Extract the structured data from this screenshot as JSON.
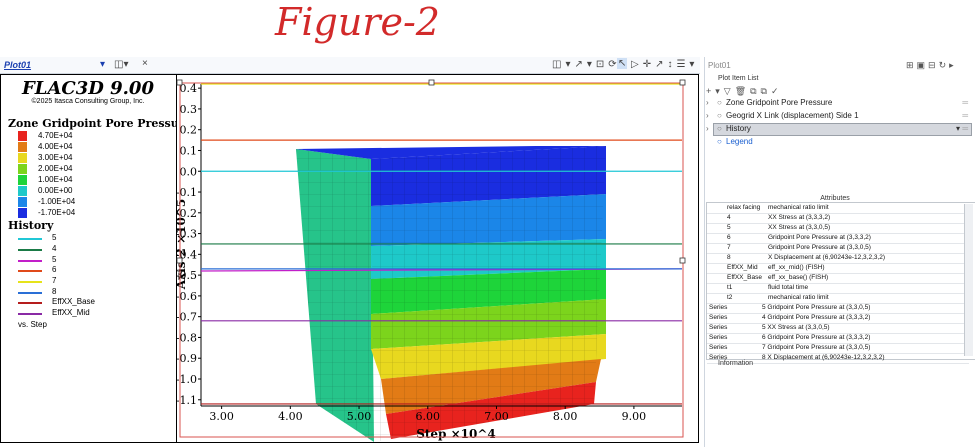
{
  "annotation": {
    "text": "Figure-2"
  },
  "left_toolbar": {
    "tab": "Plot01",
    "close": "×"
  },
  "legend": {
    "app_title": "FLAC3D 9.00",
    "copyright": "©2025 Itasca Consulting Group, Inc.",
    "contour_title": "Zone Gridpoint Pore Pressure",
    "contour_levels": [
      {
        "label": "4.70E+04",
        "color": "#e8231e"
      },
      {
        "label": "4.00E+04",
        "color": "#e27b16"
      },
      {
        "label": "3.00E+04",
        "color": "#e8d81f"
      },
      {
        "label": "2.00E+04",
        "color": "#7cd41c"
      },
      {
        "label": "1.00E+04",
        "color": "#1ed43a"
      },
      {
        "label": "0.00E+00",
        "color": "#1ec9c9"
      },
      {
        "label": "-1.00E+04",
        "color": "#1b86e8"
      },
      {
        "label": "-1.70E+04",
        "color": "#1a2de0"
      }
    ],
    "history_title": "History",
    "histories": [
      {
        "label": "5",
        "color": "#20c7d6"
      },
      {
        "label": "4",
        "color": "#1a7a46"
      },
      {
        "label": "5",
        "color": "#c21ec9"
      },
      {
        "label": "6",
        "color": "#e04a1a"
      },
      {
        "label": "7",
        "color": "#e6e31a"
      },
      {
        "label": "8",
        "color": "#2a6fd6"
      },
      {
        "label": "EffXX_Base",
        "color": "#b51d1d"
      },
      {
        "label": "EffXX_Mid",
        "color": "#8a2aa5"
      }
    ],
    "vs": "vs. Step"
  },
  "chart_data": {
    "type": "line",
    "xlabel": "Step ×10^4",
    "ylabel": "Axis-2 ×10^5",
    "xlim": [
      2.7,
      9.7
    ],
    "ylim": [
      -1.13,
      0.42
    ],
    "x_ticks": [
      "3.00",
      "4.00",
      "5.00",
      "6.00",
      "7.00",
      "8.00",
      "9.00"
    ],
    "y_ticks": [
      "0.4",
      "0.3",
      "0.2",
      "0.1",
      "0.0",
      "-0.1",
      "-0.2",
      "-0.3",
      "-0.4",
      "-0.5",
      "-0.6",
      "-0.7",
      "-0.8",
      "-0.9",
      "-1.0",
      "-1.1"
    ],
    "series": [
      {
        "name": "5",
        "color": "#20c7d6",
        "x": [
          2.7,
          9.7
        ],
        "y": [
          0.0,
          0.0
        ]
      },
      {
        "name": "4",
        "color": "#1a7a46",
        "x": [
          2.7,
          9.7
        ],
        "y": [
          -0.35,
          -0.35
        ]
      },
      {
        "name": "5",
        "color": "#c21ec9",
        "x": [
          2.7,
          9.7
        ],
        "y": [
          -0.48,
          -0.47
        ]
      },
      {
        "name": "6",
        "color": "#e04a1a",
        "x": [
          2.7,
          9.7
        ],
        "y": [
          0.15,
          0.15
        ]
      },
      {
        "name": "7",
        "color": "#e6e31a",
        "x": [
          2.7,
          9.7
        ],
        "y": [
          0.42,
          0.42
        ]
      },
      {
        "name": "8",
        "color": "#2a6fd6",
        "x": [
          2.7,
          9.7
        ],
        "y": [
          -0.47,
          -0.47
        ]
      },
      {
        "name": "EffXX_Base",
        "color": "#b51d1d",
        "x": [
          2.7,
          9.7
        ],
        "y": [
          -1.12,
          -1.12
        ]
      },
      {
        "name": "EffXX_Mid",
        "color": "#8a2aa5",
        "x": [
          2.7,
          9.7
        ],
        "y": [
          -0.72,
          -0.72
        ]
      }
    ]
  },
  "right_panel": {
    "title": "Plot01",
    "plot_item_list": "Plot Item List",
    "items": [
      {
        "label": "Zone Gridpoint Pore Pressure",
        "type": "normal"
      },
      {
        "label": "Geogrid X Link (displacement) Side 1",
        "type": "normal"
      },
      {
        "label": "History",
        "type": "selected"
      },
      {
        "label": "Legend",
        "type": "link"
      }
    ],
    "attributes_title": "Attributes",
    "attributes": [
      {
        "c1": "relax facing",
        "c2": "mechanical ratio limit",
        "series": false
      },
      {
        "c1": "4",
        "c2": "XX Stress at (3,3,3,2)",
        "series": false
      },
      {
        "c1": "5",
        "c2": "XX Stress at (3,3,0,5)",
        "series": false
      },
      {
        "c1": "6",
        "c2": "Gridpoint Pore Pressure at (3,3,3,2)",
        "series": false
      },
      {
        "c1": "7",
        "c2": "Gridpoint Pore Pressure at (3,3,0,5)",
        "series": false
      },
      {
        "c1": "8",
        "c2": "X Displacement at (6,90243e-12,3,2,3,2)",
        "series": false
      },
      {
        "c1": "EffXX_Mid",
        "c2": "eff_xx_mid() (FISH)",
        "series": false
      },
      {
        "c1": "EffXX_Base",
        "c2": "eff_xx_base() (FISH)",
        "series": false
      },
      {
        "c1": "t1",
        "c2": "fluid total time",
        "series": false
      },
      {
        "c1": "t2",
        "c2": "mechanical ratio limit",
        "series": false
      },
      {
        "c1": "Series",
        "c2": "5 Gridpoint Pore Pressure at (3,3,0,5)",
        "series": true
      },
      {
        "c1": "Series",
        "c2": "4 Gridpoint Pore Pressure at (3,3,3,2)",
        "series": true
      },
      {
        "c1": "Series",
        "c2": "5 XX Stress at (3,3,0,5)",
        "series": true
      },
      {
        "c1": "Series",
        "c2": "6 Gridpoint Pore Pressure at (3,3,3,2)",
        "series": true
      },
      {
        "c1": "Series",
        "c2": "7 Gridpoint Pore Pressure at (3,3,0,5)",
        "series": true
      },
      {
        "c1": "Series",
        "c2": "8 X Displacement at (6,90243e-12,3,2,3,2)",
        "series": true
      }
    ],
    "information": "Information"
  }
}
